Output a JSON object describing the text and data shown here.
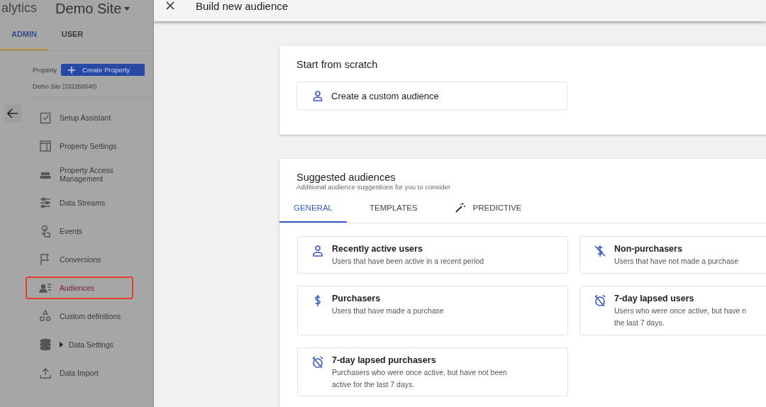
{
  "sidebar": {
    "product": "alytics",
    "account": "Demo Site",
    "tabs": [
      {
        "label": "ADMIN",
        "selected": true
      },
      {
        "label": "USER",
        "selected": false
      }
    ],
    "property_label": "Property",
    "create_button": "Create Property",
    "property_name": "Demo Site (332266640)",
    "items": [
      {
        "label": "Setup Assistant",
        "selected": false,
        "expandable": false
      },
      {
        "label": "Property Settings",
        "selected": false,
        "expandable": false
      },
      {
        "label": "Property Access Management",
        "selected": false,
        "expandable": false
      },
      {
        "label": "Data Streams",
        "selected": false,
        "expandable": false
      },
      {
        "label": "Events",
        "selected": false,
        "expandable": false
      },
      {
        "label": "Conversions",
        "selected": false,
        "expandable": false
      },
      {
        "label": "Audiences",
        "selected": true,
        "expandable": false
      },
      {
        "label": "Custom definitions",
        "selected": false,
        "expandable": false
      },
      {
        "label": "Data Settings",
        "selected": false,
        "expandable": true
      },
      {
        "label": "Data Import",
        "selected": false,
        "expandable": false
      }
    ]
  },
  "header": {
    "title": "Build new audience"
  },
  "scratch": {
    "title": "Start from scratch",
    "option": "Create a custom audience"
  },
  "suggested": {
    "title": "Suggested audiences",
    "subtitle": "Additional audience suggestions for you to consider",
    "tabs": [
      {
        "label": "GENERAL",
        "selected": true
      },
      {
        "label": "TEMPLATES",
        "selected": false
      },
      {
        "label": "PREDICTIVE",
        "selected": false
      }
    ],
    "cards": [
      {
        "title": "Recently active users",
        "lines": [
          "Users that have been active in a recent period"
        ]
      },
      {
        "title": "Non-purchasers",
        "lines": [
          "Users that have not made a purchase"
        ]
      },
      {
        "title": "Purchasers",
        "lines": [
          "Users that have made a purchase"
        ]
      },
      {
        "title": "7-day lapsed users",
        "lines": [
          "Users who were once active, but have n",
          "the last 7 days."
        ]
      },
      {
        "title": "7-day lapsed purchasers",
        "lines": [
          "Purchasers who were once active, but have not been",
          "active for the last 7 days."
        ]
      }
    ]
  }
}
